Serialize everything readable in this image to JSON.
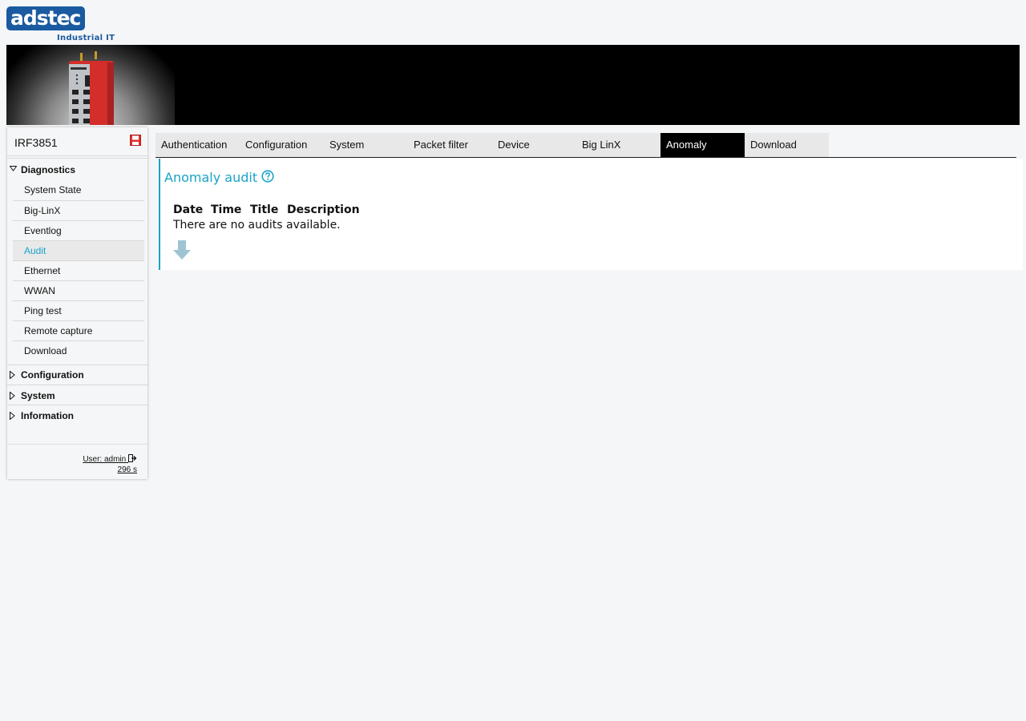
{
  "brand": {
    "logo_text": "adstec",
    "tagline": "Industrial IT"
  },
  "sidebar": {
    "device_name": "IRF3851",
    "groups": [
      {
        "label": "Diagnostics",
        "expanded": true
      },
      {
        "label": "Configuration",
        "expanded": false
      },
      {
        "label": "System",
        "expanded": false
      },
      {
        "label": "Information",
        "expanded": false
      }
    ],
    "items": [
      "System State",
      "Big-LinX",
      "Eventlog",
      "Audit",
      "Ethernet",
      "WWAN",
      "Ping test",
      "Remote capture",
      "Download"
    ],
    "active_item": "Audit",
    "user_label": "User: admin",
    "session_timer": "296 s"
  },
  "tabs": [
    "Authentication",
    "Configuration",
    "System",
    "Packet filter",
    "Device",
    "Big LinX",
    "Anomaly",
    "Download"
  ],
  "active_tab": "Anomaly",
  "content": {
    "title": "Anomaly audit",
    "columns": [
      "Date",
      "Time",
      "Title",
      "Description"
    ],
    "empty_message": "There are no audits available."
  },
  "colors": {
    "accent": "#1aa3c8",
    "brand": "#1a5aa0",
    "device_red": "#e0322f",
    "active_tab_bg": "#000000"
  },
  "icons": [
    "save-icon",
    "help-icon",
    "logout-icon",
    "download-arrow-icon",
    "triangle-down-icon",
    "triangle-right-icon"
  ]
}
